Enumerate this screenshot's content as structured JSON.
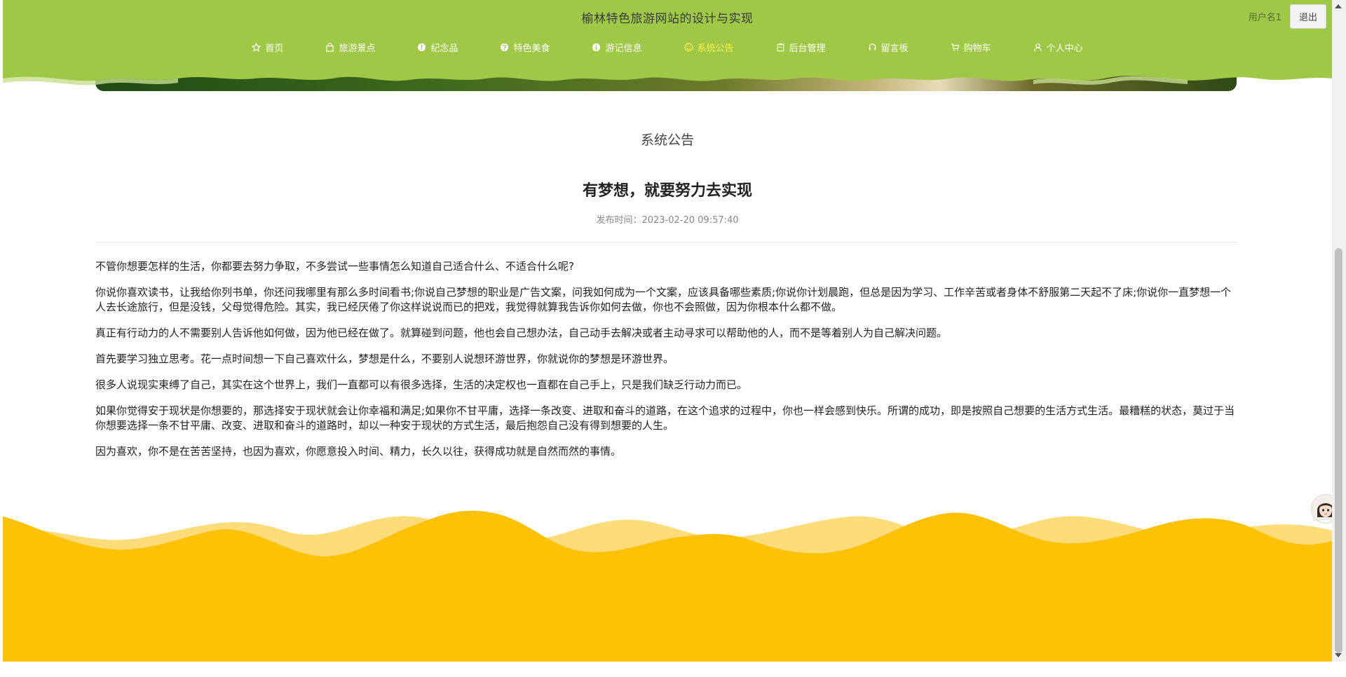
{
  "header": {
    "site_title": "榆林特色旅游网站的设计与实现",
    "user_name": "用户名1",
    "logout_label": "退出",
    "green_color": "#9ec845"
  },
  "nav": {
    "items": [
      {
        "label": "首页",
        "icon": "star-icon"
      },
      {
        "label": "旅游景点",
        "icon": "bag-icon"
      },
      {
        "label": "纪念品",
        "icon": "info-icon"
      },
      {
        "label": "特色美食",
        "icon": "question-icon"
      },
      {
        "label": "游记信息",
        "icon": "info-icon"
      },
      {
        "label": "系统公告",
        "icon": "smile-icon",
        "active": true
      },
      {
        "label": "后台管理",
        "icon": "clipboard-icon"
      },
      {
        "label": "留言板",
        "icon": "headset-icon"
      },
      {
        "label": "购物车",
        "icon": "cart-icon"
      },
      {
        "label": "个人中心",
        "icon": "user-icon"
      }
    ],
    "active_color": "#fff04a"
  },
  "content": {
    "section_title": "系统公告",
    "article_title": "有梦想，就要努力去实现",
    "publish_label": "发布时间：",
    "publish_time": "2023-02-20 09:57:40",
    "paragraphs": [
      "不管你想要怎样的生活，你都要去努力争取，不多尝试一些事情怎么知道自己适合什么、不适合什么呢?",
      "你说你喜欢读书，让我给你列书单，你还问我哪里有那么多时间看书;你说自己梦想的职业是广告文案，问我如何成为一个文案，应该具备哪些素质;你说你计划晨跑，但总是因为学习、工作辛苦或者身体不舒服第二天起不了床;你说你一直梦想一个人去长途旅行，但是没钱，父母觉得危险。其实，我已经厌倦了你这样说说而已的把戏，我觉得就算我告诉你如何去做，你也不会照做，因为你根本什么都不做。",
      "真正有行动力的人不需要别人告诉他如何做，因为他已经在做了。就算碰到问题，他也会自己想办法，自己动手去解决或者主动寻求可以帮助他的人，而不是等着别人为自己解决问题。",
      "首先要学习独立思考。花一点时间想一下自己喜欢什么，梦想是什么，不要别人说想环游世界，你就说你的梦想是环游世界。",
      "很多人说现实束缚了自己，其实在这个世界上，我们一直都可以有很多选择，生活的决定权也一直都在自己手上，只是我们缺乏行动力而已。",
      "如果你觉得安于现状是你想要的，那选择安于现状就会让你幸福和满足;如果你不甘平庸，选择一条改变、进取和奋斗的道路，在这个追求的过程中，你也一样会感到快乐。所谓的成功，即是按照自己想要的生活方式生活。最糟糕的状态，莫过于当你想要选择一条不甘平庸、改变、进取和奋斗的道路时，却以一种安于现状的方式生活，最后抱怨自己没有得到想要的人生。",
      "因为喜欢，你不是在苦苦坚持，也因为喜欢，你愿意投入时间、精力，长久以往，获得成功就是自然而然的事情。"
    ]
  },
  "footer": {
    "wave_color": "#fdc105",
    "wave_light_color": "#fedc7a"
  }
}
